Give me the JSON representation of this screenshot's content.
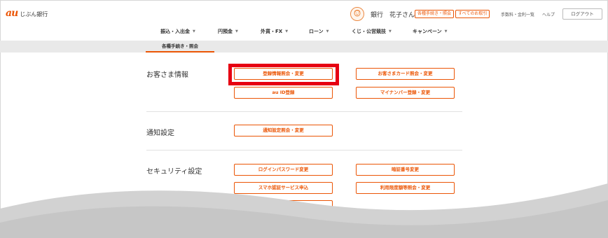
{
  "header": {
    "logo_mark": "au",
    "logo_text": "じぶん銀行",
    "user_name": "銀行　花子さん",
    "pill_procedures": "各種手続き・照会",
    "pill_transactions": "すべてのお取引",
    "fees_link": "手数料・金利一覧",
    "help_link": "ヘルプ",
    "logout_label": "ログアウト"
  },
  "gnav": {
    "items": [
      "振込・入出金",
      "円預金",
      "外貨・FX",
      "ローン",
      "くじ・公営競技",
      "キャンペーン"
    ]
  },
  "subnav": {
    "active_label": "各種手続き・照会"
  },
  "sections": {
    "customer": {
      "title": "お客さま情報",
      "buttons": [
        "登録情報照会・変更",
        "お客さまカード照会・変更",
        "au ID登録",
        "マイナンバー登録・変更"
      ]
    },
    "notification": {
      "title": "通知設定",
      "buttons": [
        "通知設定照会・変更"
      ]
    },
    "security": {
      "title": "セキュリティ設定",
      "buttons": [
        "ログインパスワード変更",
        "暗証番号変更",
        "スマホ認証サービス申込",
        "利用限度額等照会・変更"
      ]
    }
  },
  "colors": {
    "accent": "#eb5505",
    "highlight": "#e60012",
    "subnav_bg": "#e9e9e9",
    "wave": "#c8c8c8"
  }
}
